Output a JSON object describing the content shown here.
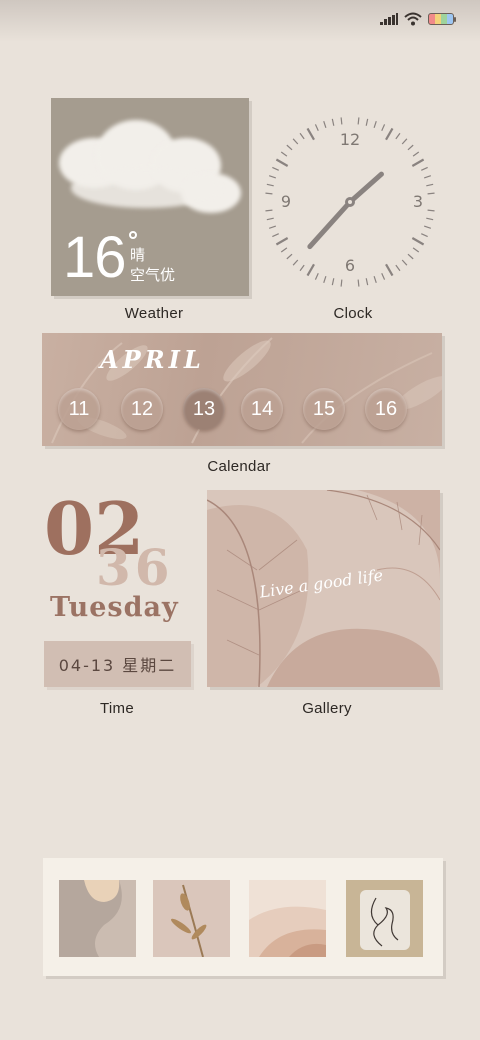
{
  "status_bar": {
    "signal_icon": "cellular-signal-icon",
    "wifi_icon": "wifi-icon",
    "battery_icon": "battery-icon"
  },
  "weather": {
    "temperature": "16",
    "condition": "晴",
    "air_quality": "空气优",
    "label": "Weather"
  },
  "clock": {
    "numbers": [
      "12",
      "3",
      "6",
      "9"
    ],
    "label": "Clock",
    "hour": 1,
    "minute": 37
  },
  "calendar": {
    "month": "APRIL",
    "days": [
      "11",
      "12",
      "13",
      "14",
      "15",
      "16"
    ],
    "today": "13",
    "label": "Calendar"
  },
  "time_widget": {
    "hour": "02",
    "minute": "36",
    "weekday": "Tuesday",
    "date": "04-13 星期二",
    "label": "Time"
  },
  "gallery": {
    "caption": "Live a good life",
    "label": "Gallery"
  },
  "dock": {
    "apps": [
      "app-1",
      "app-2",
      "app-3",
      "app-4"
    ]
  },
  "colors": {
    "background": "#e9e2da",
    "accent": "#9b7364",
    "clock_hands": "#8a8380"
  }
}
